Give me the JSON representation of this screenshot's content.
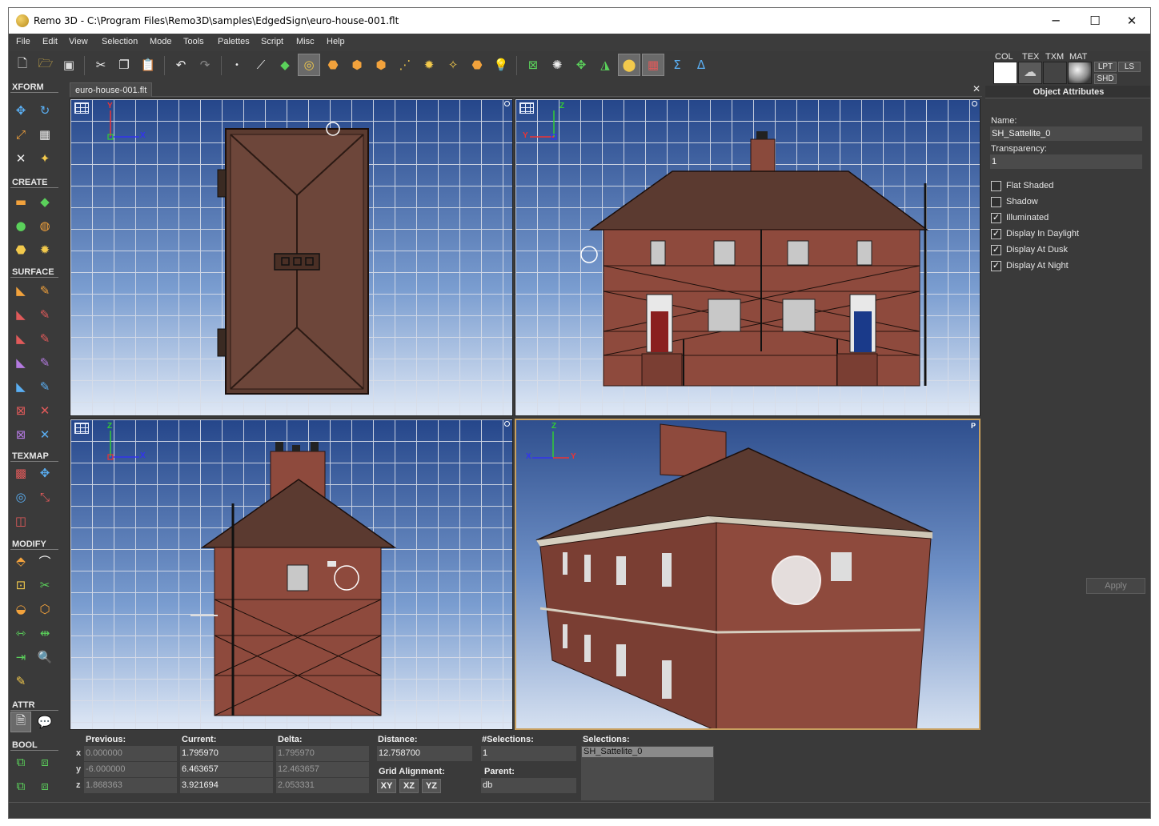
{
  "window": {
    "title": "Remo 3D - C:\\Program Files\\Remo3D\\samples\\EdgedSign\\euro-house-001.flt",
    "minimize": "─",
    "maximize": "☐",
    "close": "✕"
  },
  "menu": [
    "File",
    "Edit",
    "View",
    "Selection",
    "Mode",
    "Tools",
    "Palettes",
    "Script",
    "Misc",
    "Help"
  ],
  "material": {
    "labels": [
      "COL",
      "TEX",
      "TXM",
      "MAT"
    ],
    "buttons": [
      "LPT",
      "LS",
      "SHD"
    ]
  },
  "toolbox": {
    "sections": [
      "XFORM",
      "CREATE",
      "SURFACE",
      "TEXMAP",
      "MODIFY",
      "ATTR",
      "BOOL"
    ]
  },
  "document": {
    "tab": "euro-house-001.flt",
    "close": "✕"
  },
  "viewports": {
    "top": {
      "axis_v": "Y",
      "axis_h": "X"
    },
    "front": {
      "axis_v": "Z",
      "axis_h": "Y"
    },
    "side": {
      "axis_v": "Z",
      "axis_h": "X"
    },
    "perspective": {
      "axis_v": "Z",
      "axis_h_left": "X",
      "axis_h_right": "Y",
      "mark": "P"
    }
  },
  "attributes": {
    "title": "Object Attributes",
    "name_label": "Name:",
    "name_value": "SH_Sattelite_0",
    "transparency_label": "Transparency:",
    "transparency_value": "1",
    "checkboxes": [
      {
        "label": "Flat Shaded",
        "checked": false
      },
      {
        "label": "Shadow",
        "checked": false
      },
      {
        "label": "Illuminated",
        "checked": true
      },
      {
        "label": "Display In Daylight",
        "checked": true
      },
      {
        "label": "Display At Dusk",
        "checked": true
      },
      {
        "label": "Display At Night",
        "checked": true
      }
    ],
    "apply_label": "Apply"
  },
  "status": {
    "previous_label": "Previous:",
    "current_label": "Current:",
    "delta_label": "Delta:",
    "distance_label": "Distance:",
    "selcount_label": "#Selections:",
    "selections_label": "Selections:",
    "axes": [
      "x",
      "y",
      "z"
    ],
    "previous": [
      "0.000000",
      "-6.000000",
      "1.868363"
    ],
    "current": [
      "1.795970",
      "6.463657",
      "3.921694"
    ],
    "delta": [
      "1.795970",
      "12.463657",
      "2.053331"
    ],
    "distance": "12.758700",
    "selcount": "1",
    "selection_item": "SH_Sattelite_0",
    "grid_alignment_label": "Grid Alignment:",
    "grid_buttons": [
      "XY",
      "XZ",
      "YZ"
    ],
    "parent_label": "Parent:",
    "parent_value": "db"
  }
}
